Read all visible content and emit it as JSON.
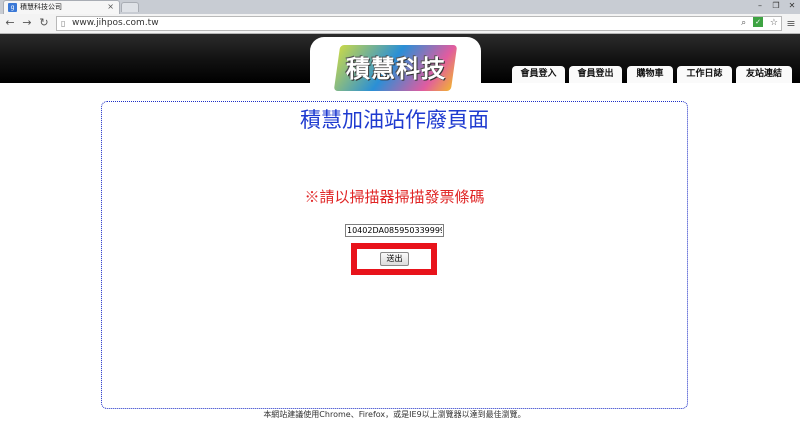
{
  "browser": {
    "tab_title": "積慧科技公司",
    "tab_close": "×",
    "tab_favicon": "g",
    "url": "www.jihpos.com.tw",
    "icons": {
      "back": "back-arrow-icon",
      "forward": "forward-arrow-icon",
      "reload": "reload-icon",
      "page": "page-icon",
      "zoom": "magnifier-icon",
      "extension": "extension-icon",
      "bookmark": "star-icon",
      "menu": "hamburger-menu-icon"
    }
  },
  "header": {
    "logo_text": "積慧科技",
    "nav": [
      {
        "label": "會員登入"
      },
      {
        "label": "會員登出"
      },
      {
        "label": "購物車"
      },
      {
        "label": "工作日誌"
      },
      {
        "label": "友站連結"
      }
    ]
  },
  "main": {
    "title": "積慧加油站作廢頁面",
    "instruction": "※請以掃描器掃描發票條碼",
    "invoice_input_value": "10402DA085950339999",
    "submit_label": "送出"
  },
  "footer": {
    "note": "本網站建議使用Chrome、Firefox，或是IE9以上瀏覽器以達到最佳瀏覽。"
  },
  "colors": {
    "title": "#1f3bd0",
    "instruction": "#e02424",
    "highlight": "#e8131b",
    "header_bg": "#111111",
    "panel_border": "#1d2fc6"
  }
}
